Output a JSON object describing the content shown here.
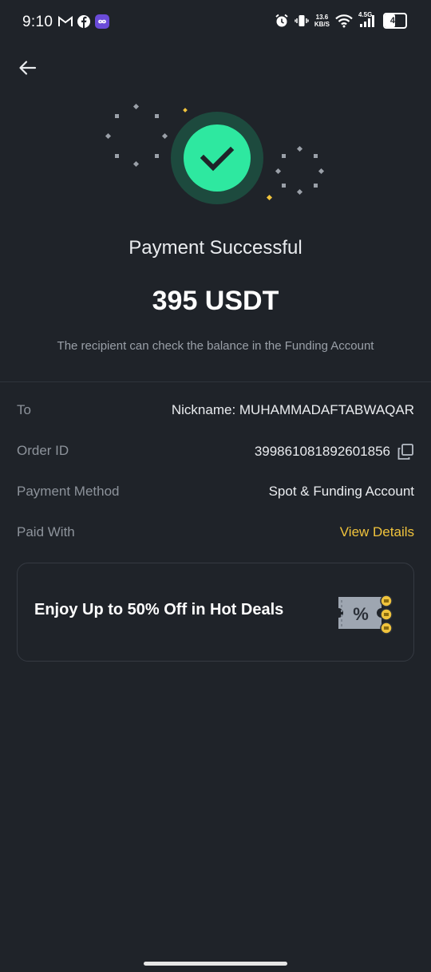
{
  "status_bar": {
    "time": "9:10",
    "net_speed_value": "13.6",
    "net_speed_unit": "KB/S",
    "network_type": "4.5G",
    "battery": "49",
    "battery_level": 0.49
  },
  "header": {
    "back_icon": "arrow-left-icon"
  },
  "hero": {
    "icon": "check-circle-icon",
    "accent_color": "#2ee8a0",
    "title": "Payment Successful",
    "amount": "395 USDT",
    "subtitle": "The recipient can check the balance in the Funding Account"
  },
  "details": {
    "to": {
      "label": "To",
      "value": "Nickname: MUHAMMADAFTABWAQAR"
    },
    "order_id": {
      "label": "Order ID",
      "value": "399861081892601856",
      "icon": "copy-icon"
    },
    "payment_method": {
      "label": "Payment Method",
      "value": "Spot & Funding Account"
    },
    "paid_with": {
      "label": "Paid With",
      "value": "View Details",
      "link_color": "#f0c33c"
    }
  },
  "promo": {
    "text": "Enjoy Up to 50% Off in Hot Deals",
    "icon": "discount-coupon-icon"
  }
}
